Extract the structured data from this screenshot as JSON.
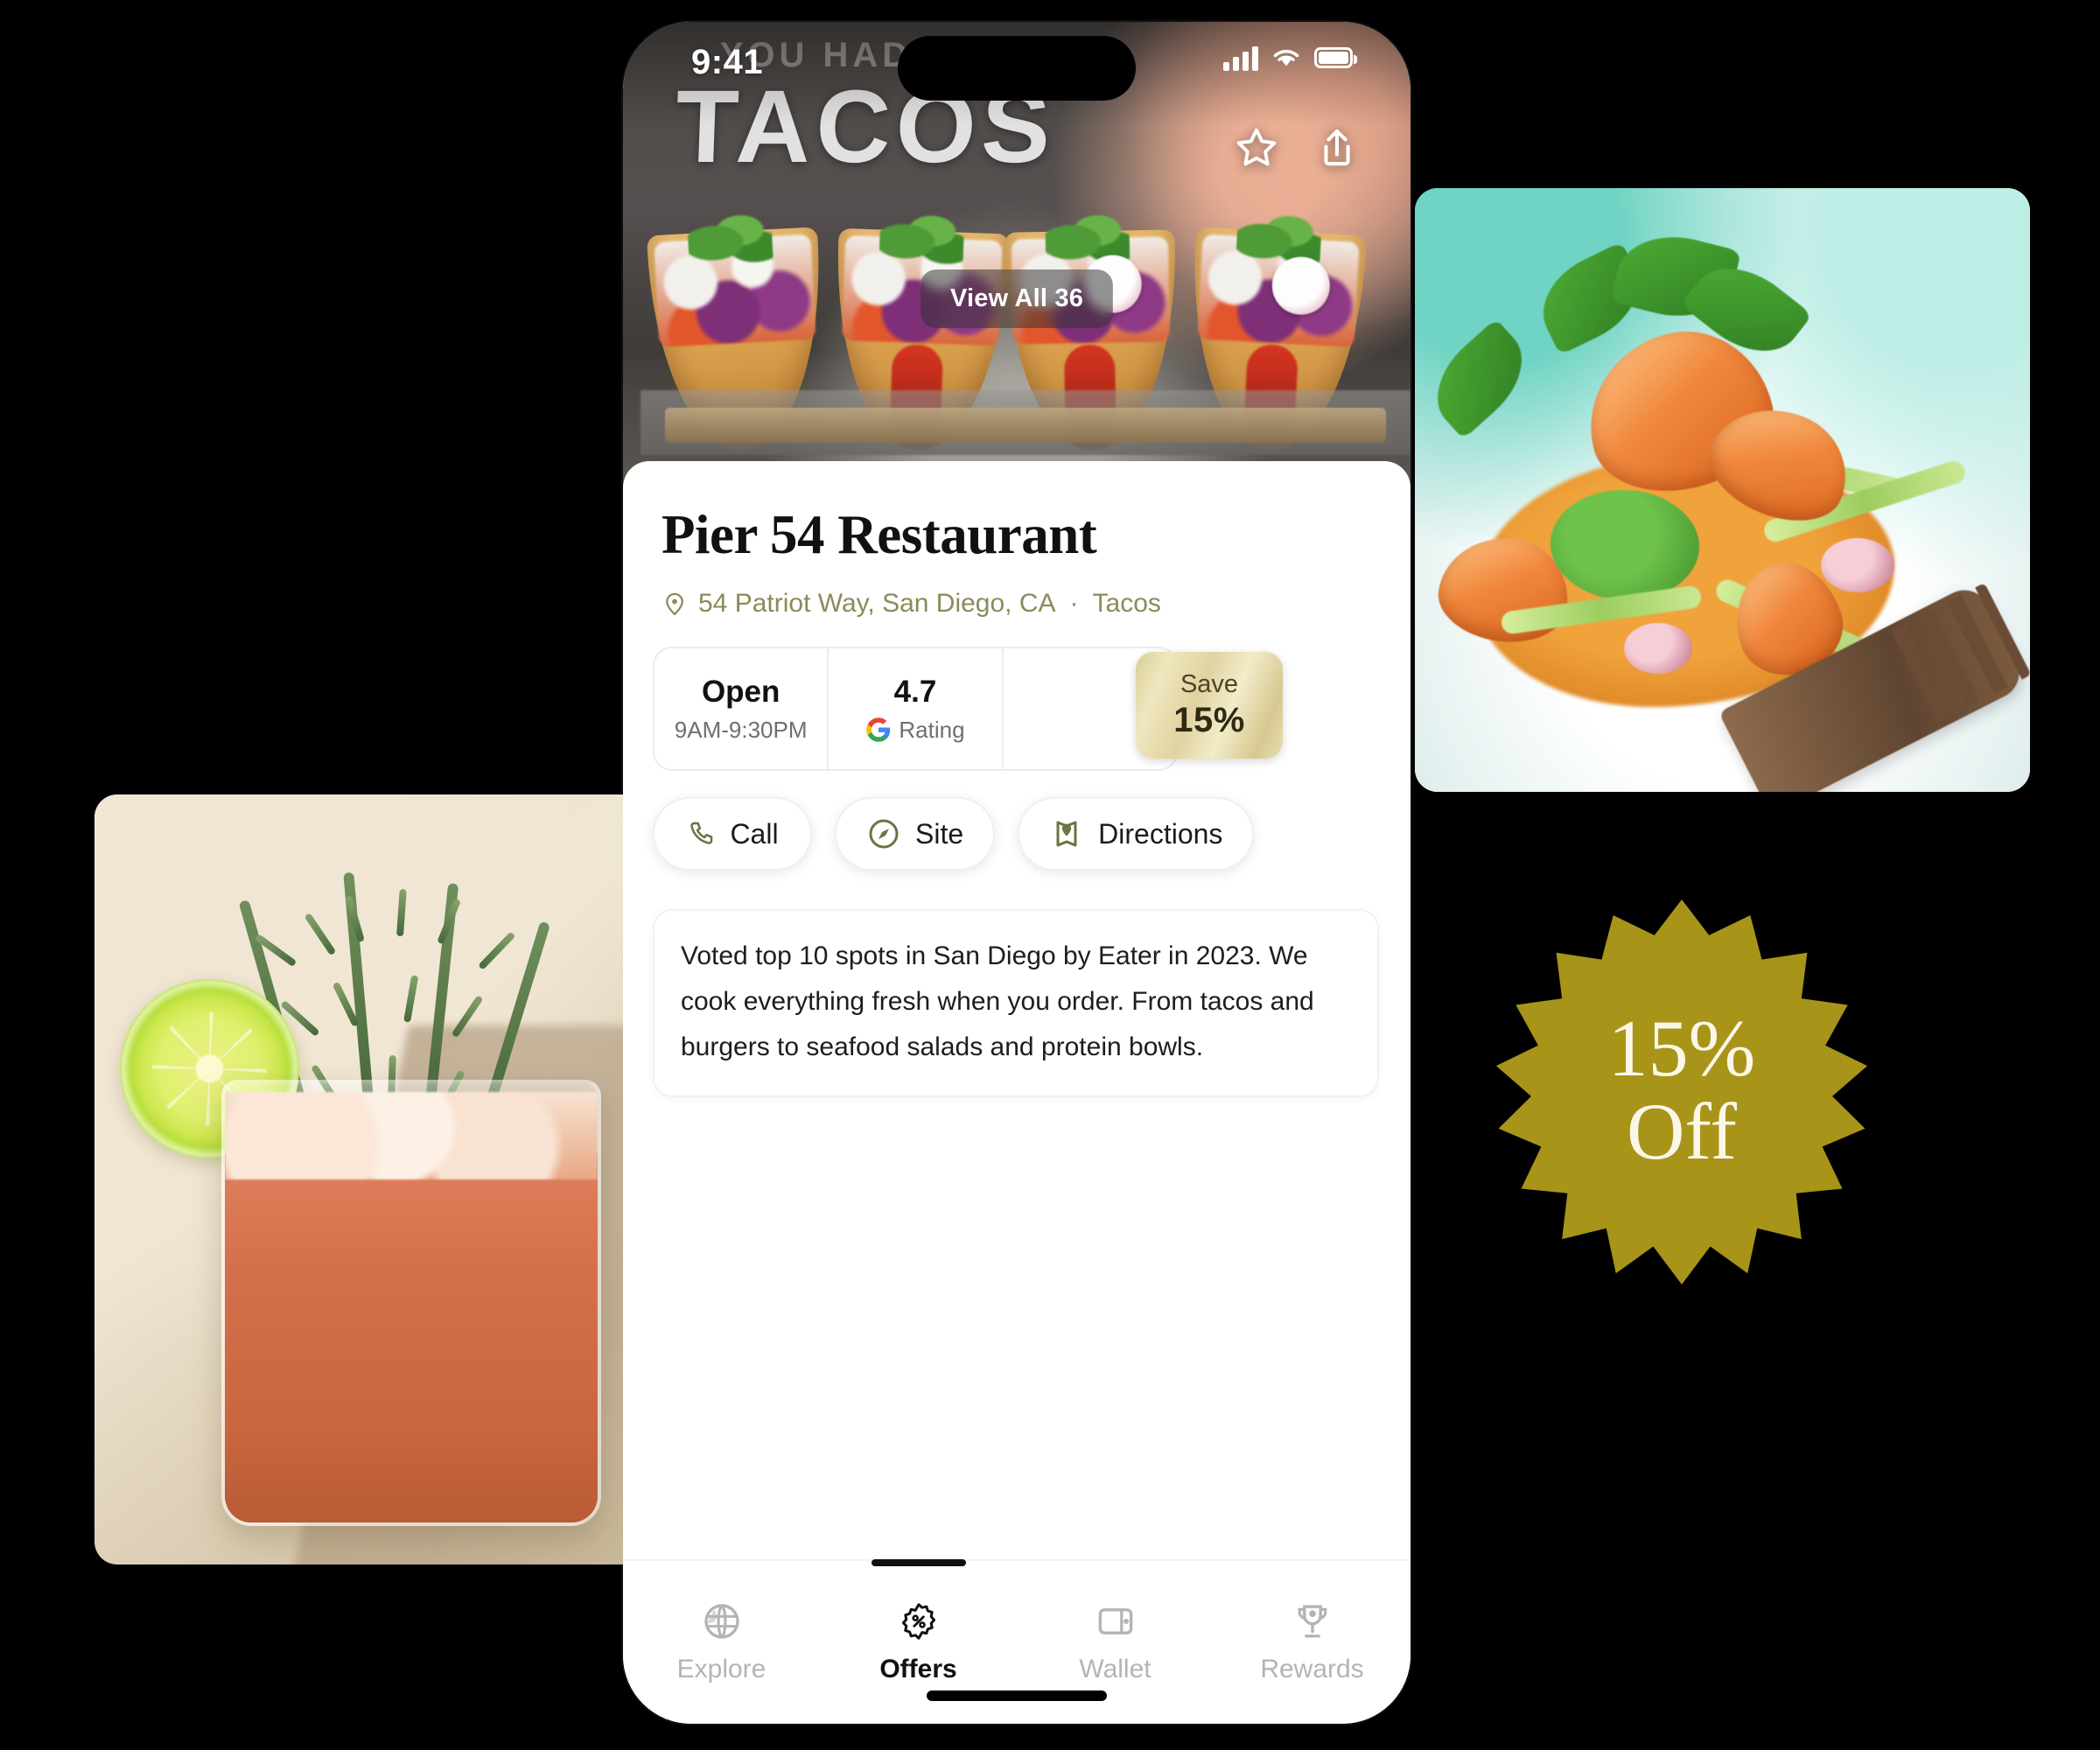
{
  "status_bar": {
    "time": "9:41",
    "signal_icon": "cellular-bars-icon",
    "wifi_icon": "wifi-icon",
    "battery_icon": "battery-icon"
  },
  "hero": {
    "shirt_text": "TACOS",
    "view_all_label": "View All 36",
    "favorite_icon": "star-icon",
    "share_icon": "share-icon",
    "photo_alt": "tacos-photo"
  },
  "place": {
    "name": "Pier 54 Restaurant",
    "address": "54 Patriot Way, San Diego, CA",
    "separator": "·",
    "category": "Tacos",
    "pin_icon": "location-pin-icon"
  },
  "info": {
    "status_label": "Open",
    "hours": "9AM-9:30PM",
    "rating_value": "4.7",
    "rating_source": "Rating",
    "google_icon": "google-g-icon",
    "save_title": "Save",
    "save_amount": "15%"
  },
  "actions": [
    {
      "label": "Call",
      "icon": "phone-icon"
    },
    {
      "label": "Site",
      "icon": "compass-icon"
    },
    {
      "label": "Directions",
      "icon": "map-pin-icon"
    }
  ],
  "description": "Voted top 10 spots in San Diego by Eater in 2023. We cook everything fresh when you order. From tacos and burgers to seafood salads and protein bowls.",
  "tabs": [
    {
      "label": "Explore",
      "icon": "globe-icon",
      "active": false
    },
    {
      "label": "Offers",
      "icon": "offer-badge-percent-icon",
      "active": true
    },
    {
      "label": "Wallet",
      "icon": "wallet-icon",
      "active": false
    },
    {
      "label": "Rewards",
      "icon": "trophy-icon",
      "active": false
    }
  ],
  "floating_photos": [
    {
      "name": "seafood-dish-photo",
      "alt": "shrimp salad plate with fork"
    },
    {
      "name": "cocktail-photo",
      "alt": "cocktail with lime wheel and rosemary"
    }
  ],
  "starburst": {
    "line1": "15%",
    "line2": "Off",
    "color": "#a89419",
    "text_color": "#fbf7e8"
  },
  "colors": {
    "background": "#000000",
    "accent_olive": "#8c8a58",
    "gold": "#a89419",
    "gold_badge_light": "#efe7bf",
    "text_primary": "#111111",
    "text_muted": "#6f6f6f"
  }
}
